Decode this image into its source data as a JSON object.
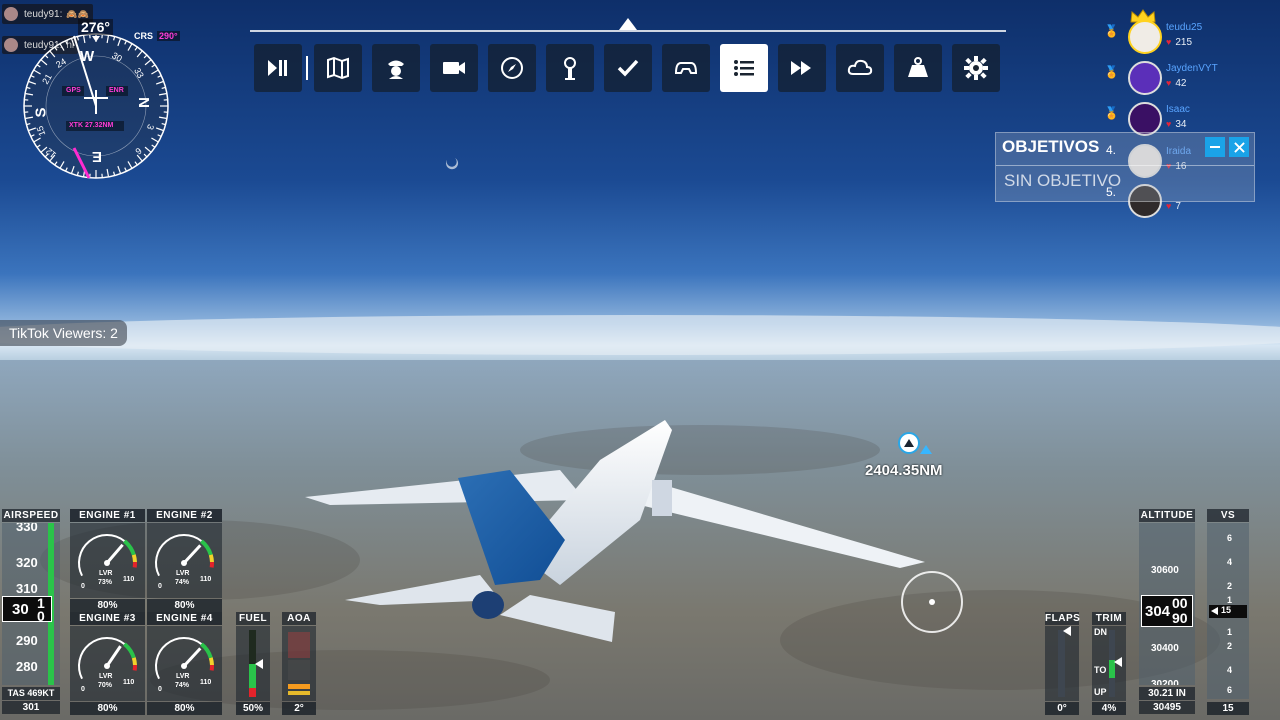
{
  "chat": {
    "line1": {
      "user": "teudy91:",
      "msg": "🙈🙈"
    },
    "line2": {
      "user": "teudy91:",
      "msg": "hi"
    }
  },
  "compass": {
    "heading": "276°",
    "crs_label": "CRS",
    "crs_value": "290°",
    "gps": "GPS",
    "enr": "ENR",
    "xtk": "XTK 27.32NM",
    "letters": [
      "W",
      "S",
      "N",
      "E"
    ],
    "ticks": [
      "30",
      "33",
      "24",
      "21",
      "3",
      "6",
      "12",
      "15"
    ]
  },
  "toolbar": {
    "buttons": [
      {
        "name": "pause-active-pause-button",
        "icon": "play-pause-icon"
      },
      {
        "name": "vfr-map-button",
        "icon": "map-icon"
      },
      {
        "name": "atc-button",
        "icon": "pilot-icon"
      },
      {
        "name": "camera-button",
        "icon": "camera-icon"
      },
      {
        "name": "navlog-button",
        "icon": "compass-icon"
      },
      {
        "name": "weather-station-button",
        "icon": "tower-icon"
      },
      {
        "name": "checklist-button",
        "icon": "check-icon"
      },
      {
        "name": "assistance-button",
        "icon": "cockpit-icon"
      },
      {
        "name": "objectives-button",
        "icon": "list-icon"
      },
      {
        "name": "sim-rate-button",
        "icon": "fast-forward-icon"
      },
      {
        "name": "weather-button",
        "icon": "cloud-icon"
      },
      {
        "name": "weight-button",
        "icon": "weight-icon"
      },
      {
        "name": "settings-button",
        "icon": "gear-icon"
      }
    ],
    "active_index": 8
  },
  "leaderboard": [
    {
      "name": "teudu25",
      "score": "215",
      "badge": "crown"
    },
    {
      "name": "JaydenVYT",
      "score": "42",
      "badge": "medal"
    },
    {
      "name": "Isaac",
      "score": "34",
      "badge": "medal"
    },
    {
      "name": "Iraida",
      "score": "16",
      "badge": ""
    },
    {
      "name": "",
      "score": "7",
      "badge": ""
    }
  ],
  "objectives": {
    "title": "OBJETIVOS",
    "empty": "SIN OBJETIVO",
    "rank4": "4.",
    "rank5": "5."
  },
  "tiktok": {
    "viewers": "TikTok Viewers: 2"
  },
  "waypoint": {
    "distance": "2404.35NM"
  },
  "airspeed": {
    "label": "AIRSPEED",
    "ticks": [
      "330",
      "320",
      "310",
      "290",
      "280"
    ],
    "current": "30",
    "roll1": "1",
    "roll0": "0",
    "tas": "TAS 469KT",
    "value": "301"
  },
  "engines": [
    {
      "label": "ENGINE #1",
      "lvr": "LVR",
      "lvr_pct": "73%",
      "min": "0",
      "max": "110",
      "pct": "80%",
      "value": 0.73
    },
    {
      "label": "ENGINE #2",
      "lvr": "LVR",
      "lvr_pct": "74%",
      "min": "0",
      "max": "110",
      "pct": "80%",
      "value": 0.74
    },
    {
      "label": "ENGINE #3",
      "lvr": "LVR",
      "lvr_pct": "70%",
      "min": "0",
      "max": "110",
      "pct": "80%",
      "value": 0.7
    },
    {
      "label": "ENGINE #4",
      "lvr": "LVR",
      "lvr_pct": "74%",
      "min": "0",
      "max": "110",
      "pct": "80%",
      "value": 0.74
    }
  ],
  "fuel": {
    "label": "FUEL",
    "pct": "50%",
    "level": 0.5
  },
  "aoa": {
    "label": "AOA",
    "value": "2°"
  },
  "flaps": {
    "label": "FLAPS",
    "value": "0°"
  },
  "trim": {
    "label": "TRIM",
    "dn": "DN",
    "to": "TO",
    "up": "UP",
    "value": "4%"
  },
  "altitude": {
    "label": "ALTITUDE",
    "ticks": [
      "30600",
      "30400",
      "30200"
    ],
    "current_hi": "304",
    "current_lo_top": "00",
    "current_lo_bot": "90",
    "baro": "30.21 IN",
    "value": "30495"
  },
  "vs": {
    "label": "VS",
    "ticks": [
      "6",
      "4",
      "2",
      "1",
      "1",
      "2",
      "4",
      "6"
    ],
    "bug": "15",
    "value": "15"
  }
}
